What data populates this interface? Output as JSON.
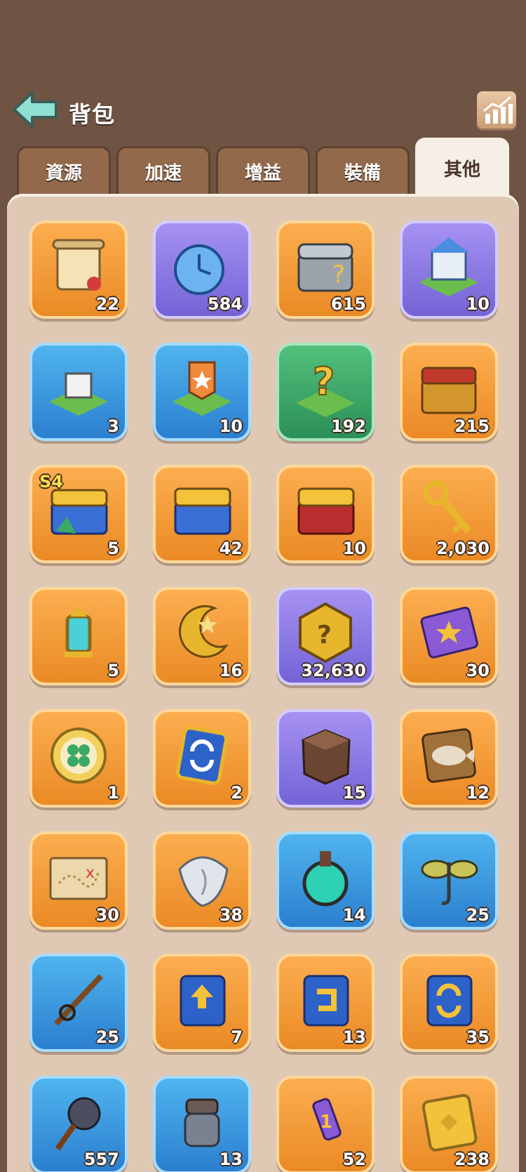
{
  "header": {
    "title": "背包",
    "back_icon": "back-arrow-icon",
    "stats_icon": "stats-chart-icon"
  },
  "tabs": [
    {
      "label": "資源",
      "active": false
    },
    {
      "label": "加速",
      "active": false
    },
    {
      "label": "增益",
      "active": false
    },
    {
      "label": "裝備",
      "active": false
    },
    {
      "label": "其他",
      "active": true
    }
  ],
  "colors": {
    "orange": "#f09a34",
    "purple": "#8b79e3",
    "blue": "#3a9be0",
    "green": "#3aa866"
  },
  "items": [
    {
      "icon": "scroll-icon",
      "bg": "orange",
      "count": "22"
    },
    {
      "icon": "speedup-clock-icon",
      "bg": "purple",
      "count": "584"
    },
    {
      "icon": "equipment-chest-icon",
      "bg": "orange",
      "count": "615"
    },
    {
      "icon": "castle-skin-icon",
      "bg": "purple",
      "count": "10"
    },
    {
      "icon": "relocate-castle-icon",
      "bg": "blue",
      "count": "3"
    },
    {
      "icon": "territory-badge-icon",
      "bg": "blue",
      "count": "10"
    },
    {
      "icon": "random-teleport-icon",
      "bg": "green",
      "count": "192"
    },
    {
      "icon": "treasure-chest-icon",
      "bg": "orange",
      "count": "215"
    },
    {
      "icon": "season-chest-icon",
      "bg": "orange",
      "count": "5",
      "badge": "S4"
    },
    {
      "icon": "blue-chest-icon",
      "bg": "orange",
      "count": "42"
    },
    {
      "icon": "red-gold-chest-icon",
      "bg": "orange",
      "count": "10"
    },
    {
      "icon": "golden-key-icon",
      "bg": "orange",
      "count": "2,030"
    },
    {
      "icon": "lantern-icon",
      "bg": "orange",
      "count": "5"
    },
    {
      "icon": "moon-star-icon",
      "bg": "orange",
      "count": "16"
    },
    {
      "icon": "mystery-medal-icon",
      "bg": "purple",
      "count": "32,630"
    },
    {
      "icon": "star-ticket-icon",
      "bg": "orange",
      "count": "30"
    },
    {
      "icon": "clover-coin-icon",
      "bg": "orange",
      "count": "1"
    },
    {
      "icon": "exchange-ticket-icon",
      "bg": "orange",
      "count": "2"
    },
    {
      "icon": "stone-block-icon",
      "bg": "purple",
      "count": "15"
    },
    {
      "icon": "fish-plaque-icon",
      "bg": "orange",
      "count": "12"
    },
    {
      "icon": "treasure-map-icon",
      "bg": "orange",
      "count": "30"
    },
    {
      "icon": "conch-shell-icon",
      "bg": "orange",
      "count": "38"
    },
    {
      "icon": "potion-flask-icon",
      "bg": "blue",
      "count": "14"
    },
    {
      "icon": "fishing-lure-icon",
      "bg": "blue",
      "count": "25"
    },
    {
      "icon": "fishing-rod-icon",
      "bg": "blue",
      "count": "25"
    },
    {
      "icon": "upgrade-card-icon",
      "bg": "orange",
      "count": "7"
    },
    {
      "icon": "return-card-icon",
      "bg": "orange",
      "count": "13"
    },
    {
      "icon": "swap-card-icon",
      "bg": "orange",
      "count": "35"
    },
    {
      "icon": "spiked-mace-icon",
      "bg": "blue",
      "count": "557"
    },
    {
      "icon": "iron-gauntlet-icon",
      "bg": "blue",
      "count": "13"
    },
    {
      "icon": "firework-rocket-icon",
      "bg": "orange",
      "count": "52"
    },
    {
      "icon": "gold-ticket-icon",
      "bg": "orange",
      "count": "238"
    }
  ]
}
